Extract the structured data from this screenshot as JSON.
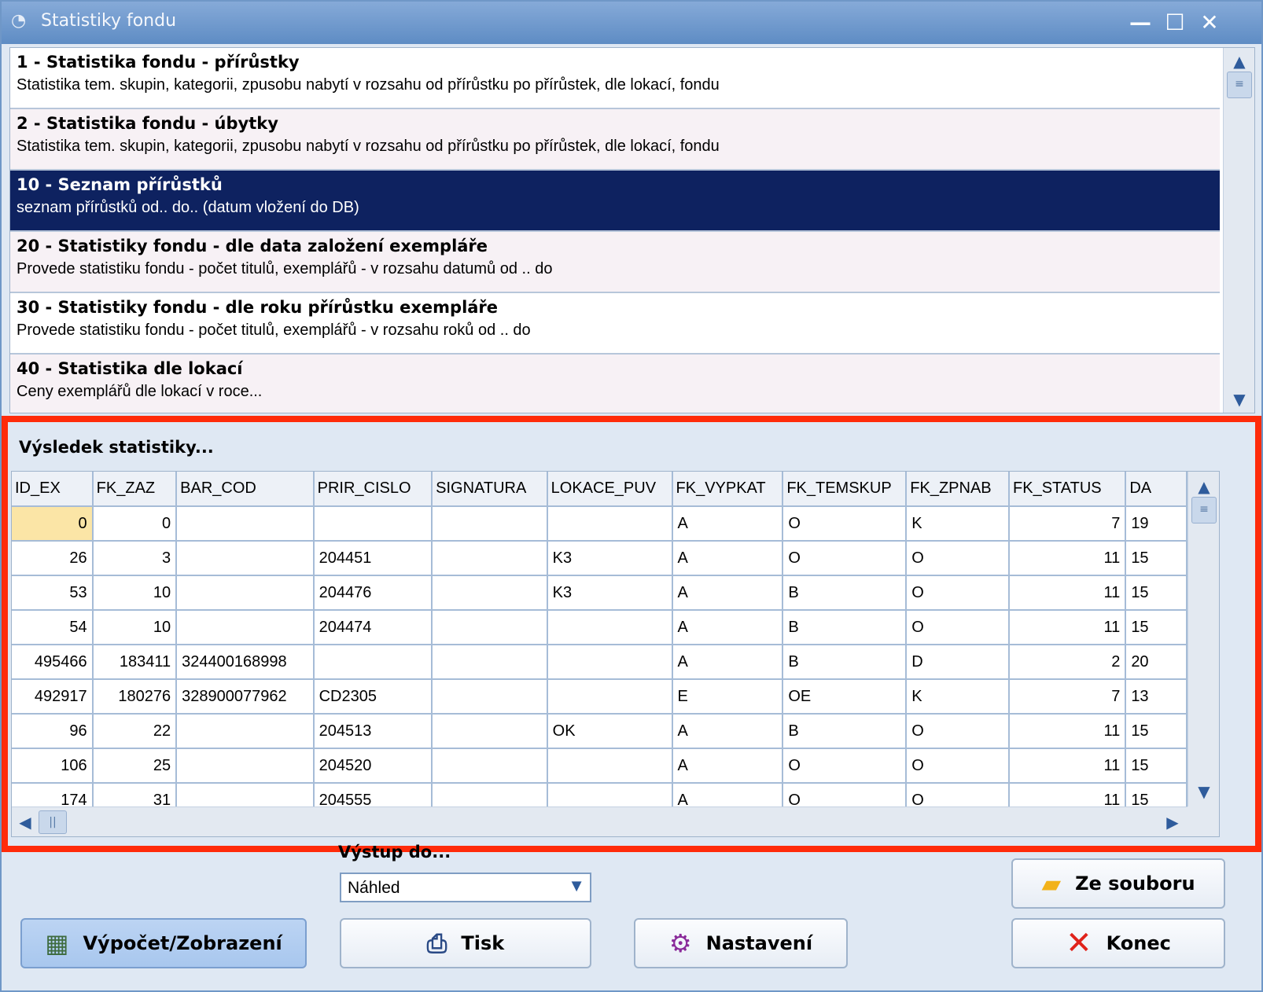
{
  "window": {
    "title": "Statistiky fondu",
    "controls": {
      "minimize": "—",
      "maximize": "☐",
      "close": "✕"
    }
  },
  "reports": [
    {
      "title": "1 - Statistika fondu - přírůstky",
      "description": "Statistika tem. skupin, kategorii, zpusobu nabytí v rozsahu  od přírůstku po přírůstek, dle lokací, fondu",
      "selected": false
    },
    {
      "title": "2 - Statistika fondu - úbytky",
      "description": "Statistika tem. skupin, kategorii, zpusobu nabytí v rozsahu  od přírůstku po přírůstek, dle lokací, fondu",
      "selected": false
    },
    {
      "title": "10 - Seznam přírůstků",
      "description": "seznam přírůstků od.. do.. (datum vložení do DB)",
      "selected": true
    },
    {
      "title": "20 - Statistiky fondu - dle data založení exempláře",
      "description": "Provede statistiku fondu - počet titulů, exemplářů - v rozsahu datumů od .. do",
      "selected": false
    },
    {
      "title": "30 - Statistiky fondu - dle roku přírůstku exempláře",
      "description": "Provede statistiku fondu - počet titulů, exemplářů - v rozsahu roků od .. do",
      "selected": false
    },
    {
      "title": "40 - Statistika  dle lokací",
      "description": "Ceny exemplářů dle lokací v roce...",
      "selected": false
    }
  ],
  "results": {
    "label": "Výsledek statistiky...",
    "columns": [
      "ID_EX",
      "FK_ZAZ",
      "BAR_COD",
      "PRIR_CISLO",
      "SIGNATURA",
      "LOKACE_PUV",
      "FK_VYPKAT",
      "FK_TEMSKUP",
      "FK_ZPNAB",
      "FK_STATUS",
      "DA"
    ],
    "rows": [
      [
        "0",
        "0",
        "",
        "",
        "",
        "",
        "A",
        "O",
        "K",
        "7",
        "19"
      ],
      [
        "26",
        "3",
        "",
        "204451",
        "",
        "K3",
        "A",
        "O",
        "O",
        "11",
        "15"
      ],
      [
        "53",
        "10",
        "",
        "204476",
        "",
        "K3",
        "A",
        "B",
        "O",
        "11",
        "15"
      ],
      [
        "54",
        "10",
        "",
        "204474",
        "",
        "",
        "A",
        "B",
        "O",
        "11",
        "15"
      ],
      [
        "495466",
        "183411",
        "324400168998",
        "",
        "",
        "",
        "A",
        "B",
        "D",
        "2",
        "20"
      ],
      [
        "492917",
        "180276",
        "328900077962",
        "CD2305",
        "",
        "",
        "E",
        "OE",
        "K",
        "7",
        "13"
      ],
      [
        "96",
        "22",
        "",
        "204513",
        "",
        "OK",
        "A",
        "B",
        "O",
        "11",
        "15"
      ],
      [
        "106",
        "25",
        "",
        "204520",
        "",
        "",
        "A",
        "O",
        "O",
        "11",
        "15"
      ],
      [
        "174",
        "31",
        "",
        "204555",
        "",
        "",
        "A",
        "O",
        "O",
        "11",
        "15"
      ]
    ]
  },
  "output": {
    "label": "Výstup do...",
    "selected": "Náhled"
  },
  "buttons": {
    "from_file": "Ze souboru",
    "compute": "Výpočet/Zobrazení",
    "print": "Tisk",
    "settings": "Nastavení",
    "exit": "Konec"
  },
  "icons": {
    "app": "app-icon",
    "folder": "folder-icon",
    "calculator": "calculator-icon",
    "printer": "printer-icon",
    "settings": "settings-icon",
    "close": "close-icon"
  },
  "colors": {
    "selection": "#0e2260",
    "highlight_border": "#ff2b0a",
    "current_cell": "#fbe5a6"
  }
}
